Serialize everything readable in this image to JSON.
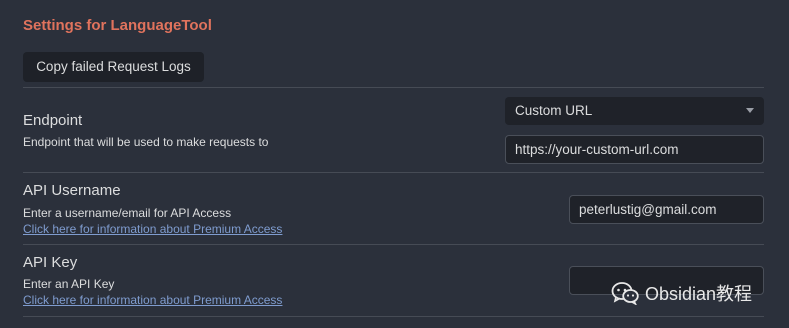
{
  "header": {
    "title": "Settings for LanguageTool",
    "copy_logs_label": "Copy failed Request Logs"
  },
  "endpoint": {
    "name": "Endpoint",
    "description": "Endpoint that will be used to make requests to",
    "selected": "Custom URL",
    "url_value": "https://your-custom-url.com"
  },
  "api_username": {
    "name": "API Username",
    "description": "Enter a username/email for API Access",
    "link": "Click here for information about Premium Access",
    "value": "peterlustig@gmail.com"
  },
  "api_key": {
    "name": "API Key",
    "description": "Enter an API Key",
    "link": "Click here for information about Premium Access",
    "value": ""
  },
  "watermark": {
    "text": "Obsidian教程"
  },
  "colors": {
    "background": "#2b303b",
    "title_accent": "#e0735d",
    "link": "#7f9ccf"
  },
  "icons": {
    "dropdown_caret": "chevron-down-icon",
    "watermark_logo": "wechat-icon"
  }
}
